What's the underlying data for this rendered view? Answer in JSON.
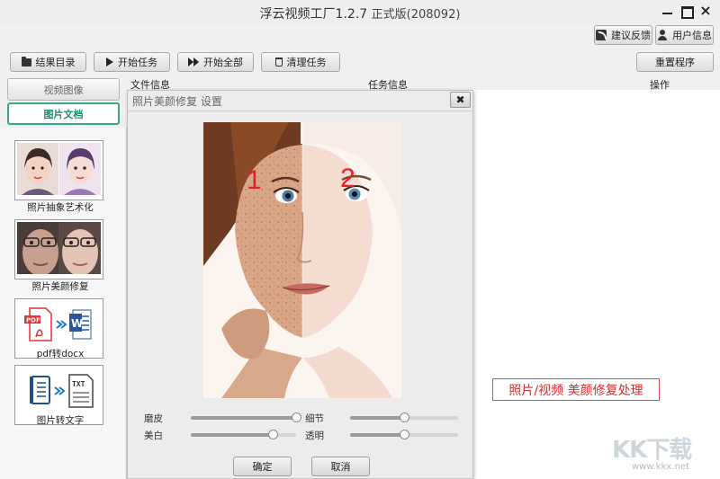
{
  "window": {
    "title": "浮云视频工厂1.2.7",
    "edition": "正式版(208092)",
    "close_glyph": "×"
  },
  "header_buttons": {
    "feedback": "建议反馈",
    "user_info": "用户信息"
  },
  "toolbar": {
    "result_dir": "结果目录",
    "start_task": "开始任务",
    "start_all": "开始全部",
    "clear_tasks": "清理任务",
    "reset": "重置程序"
  },
  "columns": {
    "file_info": "文件信息",
    "task_info": "任务信息",
    "actions": "操作"
  },
  "category_tabs": [
    {
      "label": "视频图像",
      "active": false
    },
    {
      "label": "图片文档",
      "active": true
    }
  ],
  "tools": [
    {
      "label": "照片抽象艺术化",
      "icon": "portrait-art-icon"
    },
    {
      "label": "照片美颜修复",
      "icon": "beauty-retouch-icon"
    },
    {
      "label": "pdf转docx",
      "icon": "pdf-to-word-icon"
    },
    {
      "label": "图片转文字",
      "icon": "image-to-text-icon"
    }
  ],
  "dialog": {
    "title": "照片美颜修复 设置",
    "close_glyph": "✖",
    "preview_marks": [
      "1",
      "2"
    ],
    "sliders": [
      {
        "label": "磨皮",
        "value": 1.0
      },
      {
        "label": "细节",
        "value": 0.5
      },
      {
        "label": "美白",
        "value": 0.78
      },
      {
        "label": "透明",
        "value": 0.5
      }
    ],
    "ok": "确定",
    "cancel": "取消"
  },
  "promo_text": "照片/视频 美颜修复处理",
  "watermark": {
    "logo": "KK下载",
    "url": "www.kkx.net"
  },
  "colors": {
    "accent": "#3aa58a",
    "promo_red": "#e02828",
    "mark_red": "#e8202a"
  }
}
